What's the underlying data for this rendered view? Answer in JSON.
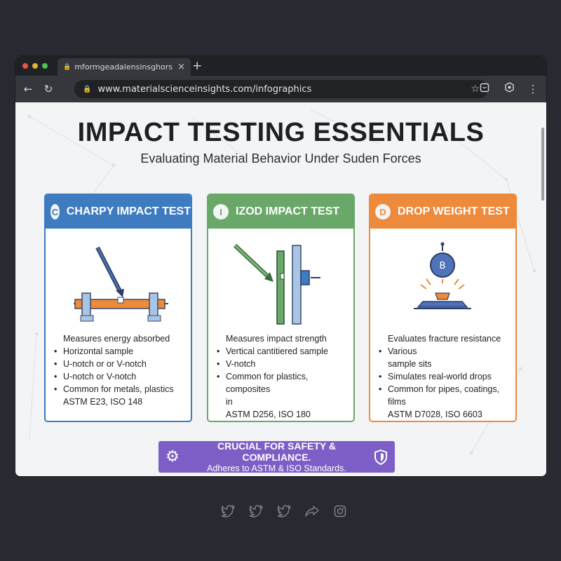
{
  "browser": {
    "tab": {
      "title": "mformgeadalensinsghors"
    },
    "toolbar": {
      "url": "www.materialscienceinsights.com/infographics"
    }
  },
  "page": {
    "title": "IMPACT TESTING ESSENTIALS",
    "subtitle": "Evaluating Material Behavior Under Suden Forces",
    "cards": [
      {
        "badge": "C",
        "title": "CHARPY IMPACT TEST",
        "color": "#3e7bc1",
        "intro": "Measures energy absorbed",
        "bullets": [
          "Horizontal sample",
          "U-notch or or V-notch",
          "U-notch or V-notch",
          "Common for metals, plastics"
        ],
        "tail": [
          "ASTM E23, ISO 148"
        ]
      },
      {
        "badge": "I",
        "title": "IZOD IMPACT TEST",
        "color": "#6aa86a",
        "intro": "Measures impact strength",
        "bullets": [
          "Vertical cantitiered sample",
          "V-notch",
          "Common for plastics, composites"
        ],
        "tail": [
          "in",
          "ASTM D256, ISO 180"
        ]
      },
      {
        "badge": "D",
        "title": "DROP WEIGHT TEST",
        "color": "#ee8a3c",
        "intro": "Evaluates fracture resistance",
        "bullets": [
          "Various"
        ],
        "tail": [
          "sample sits"
        ],
        "bullets2": [
          "Simulates real-world drops",
          "Common for pipes, coatings, films"
        ],
        "tail2": [
          "ASTM D7028, ISO 6603"
        ],
        "weight_label": "B"
      }
    ],
    "banner": {
      "line1": "CRUCIAL FOR SAFETY & COMPLIANCE.",
      "line2": "Adheres to ASTM & ISO Standards.",
      "color": "#7c5ec6"
    }
  },
  "social_icons": [
    "twitter-icon",
    "twitter-icon",
    "twitter-icon",
    "share-icon",
    "instagram-icon"
  ]
}
